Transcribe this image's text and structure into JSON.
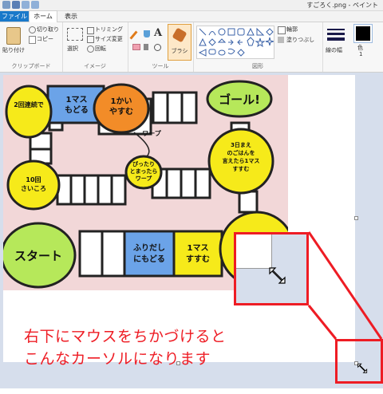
{
  "window": {
    "title": "すごろく.png - ペイント"
  },
  "tabs": {
    "file": "ファイル",
    "home": "ホーム",
    "view": "表示"
  },
  "clipboard": {
    "paste": "貼り付け",
    "cut": "切り取り",
    "copy": "コピー",
    "group": "クリップボード"
  },
  "image": {
    "select": "選択",
    "trim": "トリミング",
    "resize": "サイズ変更",
    "rotate": "回転",
    "group": "イメージ"
  },
  "tools": {
    "group": "ツール",
    "brush": "ブラシ"
  },
  "shapes": {
    "outline": "輪郭",
    "fill": "塗りつぶし",
    "group": "図形"
  },
  "size": {
    "label": "線の幅"
  },
  "color1": {
    "label1": "色",
    "label2": "1"
  },
  "board": {
    "cells": {
      "roll_again_2": "2回連続で",
      "back_1": "1マス\nもどる",
      "rest_1": "1かい\nやすむ",
      "warp_label": "ワープ",
      "goal": "ゴール!",
      "roll_10": "10回\nさいころ",
      "warp_target": "ぴったり\nとまったら\nワープ",
      "dinner": "3日まえ\nのごはんを\n言えたら1マス\nすすむ",
      "start": "スタート",
      "shake_back": "ふりだし\nにもどる",
      "advance_1": "1マス\nすすむ"
    }
  },
  "annotation": {
    "line1": "右下にマウスをちかづけると",
    "line2": "こんなカーソルになります"
  },
  "colors": {
    "accent": "#ee1c24",
    "file_tab": "#1979ca",
    "workspace": "#d6deec"
  }
}
